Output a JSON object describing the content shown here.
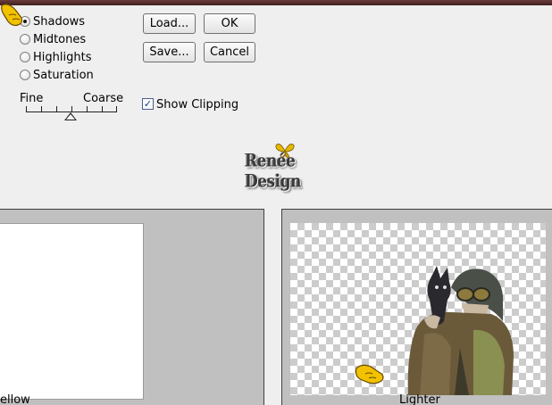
{
  "modes": [
    {
      "label": "Shadows",
      "checked": true
    },
    {
      "label": "Midtones",
      "checked": false
    },
    {
      "label": "Highlights",
      "checked": false
    },
    {
      "label": "Saturation",
      "checked": false
    }
  ],
  "buttons": {
    "load": "Load...",
    "ok": "OK",
    "save": "Save...",
    "cancel": "Cancel"
  },
  "slider": {
    "fine_label": "Fine",
    "coarse_label": "Coarse",
    "value_fraction": 0.5
  },
  "show_clipping": {
    "label": "Show Clipping",
    "checked": true,
    "check_glyph": "✓"
  },
  "logo": {
    "text": "Renée Design",
    "icon": "butterfly-icon"
  },
  "previews": {
    "left_caption": "ellow",
    "right_caption": "Lighter"
  },
  "icons": {
    "pointer": "hand-pointer-icon"
  },
  "colors": {
    "title_strip": "#5a3030",
    "dialog_bg": "#efefef",
    "panel_bg": "#c0c0c0",
    "pointer_yellow": "#f2c200"
  }
}
